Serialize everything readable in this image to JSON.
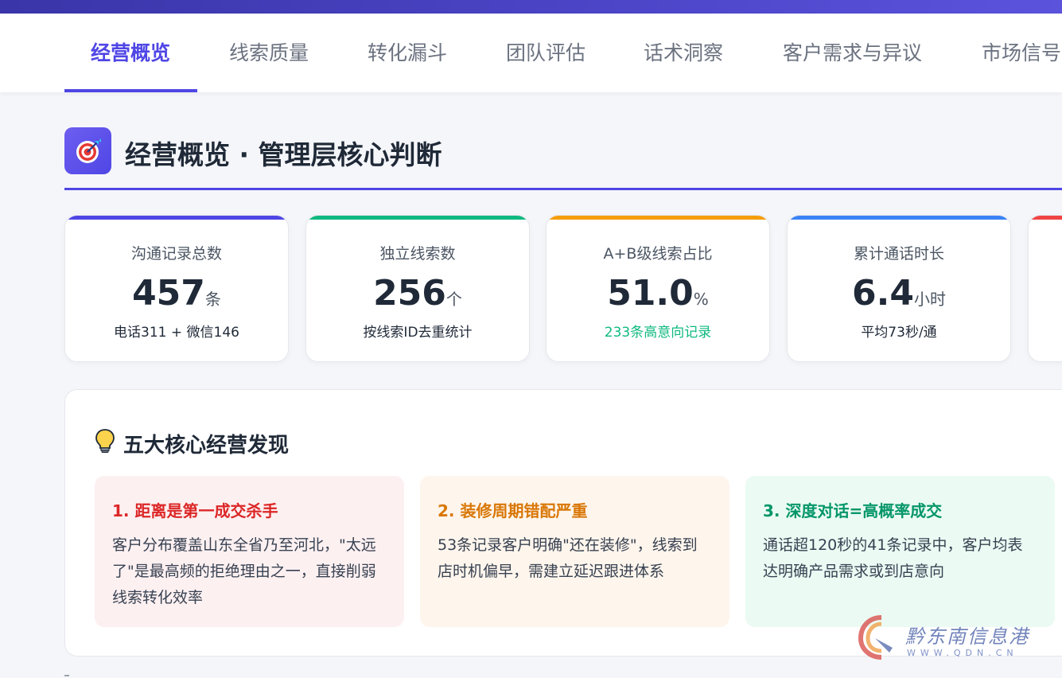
{
  "tabs": [
    {
      "label": "经营概览",
      "active": true
    },
    {
      "label": "线索质量"
    },
    {
      "label": "转化漏斗"
    },
    {
      "label": "团队评估"
    },
    {
      "label": "话术洞察"
    },
    {
      "label": "客户需求与异议"
    },
    {
      "label": "市场信号"
    }
  ],
  "section": {
    "icon": "target-icon",
    "title": "经营概览 · 管理层核心判断"
  },
  "kpis": [
    {
      "label": "沟通记录总数",
      "value": "457",
      "unit": "条",
      "sub": "电话311 + 微信146",
      "color": "#4f46e5"
    },
    {
      "label": "独立线索数",
      "value": "256",
      "unit": "个",
      "sub": "按线索ID去重统计",
      "color": "#10b981"
    },
    {
      "label": "A+B级线索占比",
      "value": "51.0",
      "unit": "%",
      "sub": "233条高意向记录",
      "color": "#f59e0b"
    },
    {
      "label": "累计通话时长",
      "value": "6.4",
      "unit": "小时",
      "sub": "平均73秒/通",
      "color": "#3b82f6"
    },
    {
      "label": "",
      "value": "",
      "unit": "",
      "sub": "",
      "color": "#ef4444"
    }
  ],
  "findings_panel": {
    "icon": "lightbulb-icon",
    "title": "五大核心经营发现",
    "items": [
      {
        "title": "1. 距离是第一成交杀手",
        "text": "客户分布覆盖山东全省乃至河北，\"太远了\"是最高频的拒绝理由之一，直接削弱线索转化效率"
      },
      {
        "title": "2. 装修周期错配严重",
        "text": "53条记录客户明确\"还在装修\"，线索到店时机偏早，需建立延迟跟进体系"
      },
      {
        "title": "3. 深度对话=高概率成交",
        "text": "通话超120秒的41条记录中，客户均表达明确产品需求或到店意向"
      }
    ]
  },
  "watermark": {
    "text": "黔东南信息港",
    "url": "WWW.QDN.CN"
  }
}
